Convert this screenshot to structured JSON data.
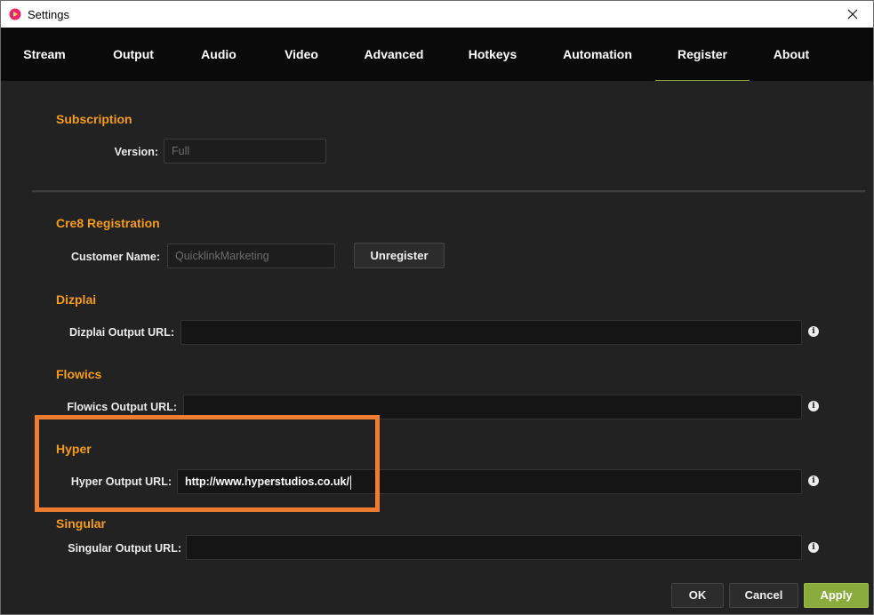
{
  "window": {
    "title": "Settings",
    "app_icon": "cre8-logo-icon",
    "close_icon": "close-icon"
  },
  "tabs": [
    {
      "label": "Stream"
    },
    {
      "label": "Output"
    },
    {
      "label": "Audio"
    },
    {
      "label": "Video"
    },
    {
      "label": "Advanced"
    },
    {
      "label": "Hotkeys"
    },
    {
      "label": "Automation"
    },
    {
      "label": "Register",
      "active": true
    },
    {
      "label": "About"
    }
  ],
  "subscription": {
    "heading": "Subscription",
    "version_label": "Version:",
    "version_value": "Full"
  },
  "registration": {
    "heading": "Cre8 Registration",
    "customer_label": "Customer Name:",
    "customer_value": "QuicklinkMarketing",
    "unregister_label": "Unregister"
  },
  "dizplai": {
    "heading": "Dizplai",
    "label": "Dizplai Output URL:",
    "value": ""
  },
  "flowics": {
    "heading": "Flowics",
    "label": "Flowics Output URL:",
    "value": ""
  },
  "hyper": {
    "heading": "Hyper",
    "label": "Hyper Output URL:",
    "value": "http://www.hyperstudios.co.uk/"
  },
  "singular": {
    "heading": "Singular",
    "label": "Singular Output URL:",
    "value": ""
  },
  "info_icon": "info-icon",
  "footer": {
    "ok_label": "OK",
    "cancel_label": "Cancel",
    "apply_label": "Apply"
  },
  "colors": {
    "accent": "#f59c1c",
    "apply": "#8aac3c",
    "highlight": "#ef7d2f",
    "background": "#222222"
  }
}
